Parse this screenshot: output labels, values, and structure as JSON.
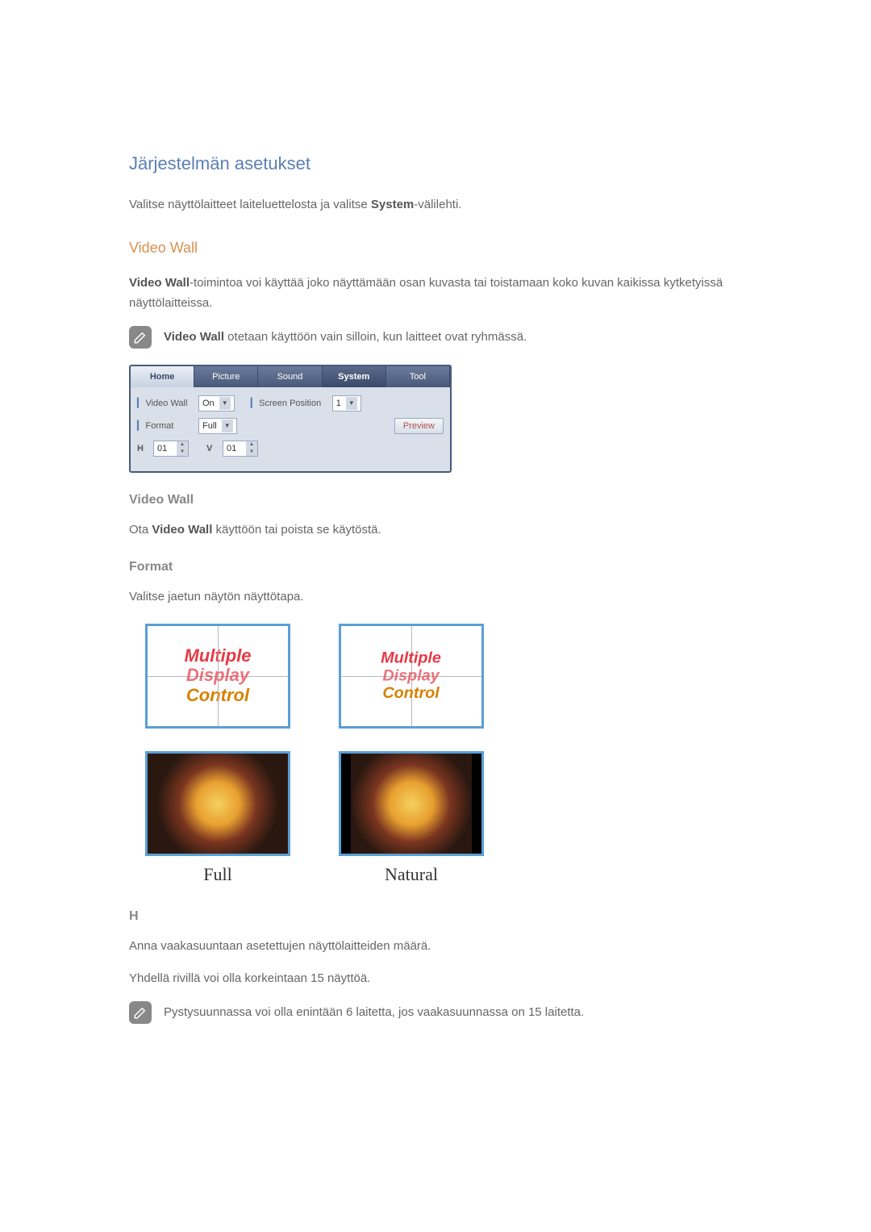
{
  "headings": {
    "system_settings": "Järjestelmän asetukset",
    "video_wall": "Video Wall",
    "vw_sub": "Video Wall",
    "format_sub": "Format",
    "h_sub": "H"
  },
  "text": {
    "intro_pre": "Valitse näyttölaitteet laiteluettelosta ja valitse ",
    "intro_bold": "System",
    "intro_post": "-välilehti.",
    "vw_desc_bold": "Video Wall",
    "vw_desc": "-toimintoa voi käyttää joko näyttämään osan kuvasta tai toistamaan koko kuvan kaikissa kytketyissä näyttölaitteissa.",
    "vw_note_bold": "Video Wall",
    "vw_note": " otetaan käyttöön vain silloin, kun laitteet ovat ryhmässä.",
    "vw_toggle_pre": "Ota ",
    "vw_toggle_bold": "Video Wall",
    "vw_toggle_post": " käyttöön tai poista se käytöstä.",
    "format_desc": "Valitse jaetun näytön näyttötapa.",
    "format_full": "Full",
    "format_natural": "Natural",
    "h_desc1": "Anna vaakasuuntaan asetettujen näyttölaitteiden määrä.",
    "h_desc2": "Yhdellä rivillä voi olla korkeintaan 15 näyttöä.",
    "h_note": "Pystysuunnassa voi olla enintään 6 laitetta, jos vaakasuunnassa on 15 laitetta."
  },
  "panel": {
    "tabs": [
      "Home",
      "Picture",
      "Sound",
      "System",
      "Tool"
    ],
    "video_wall_label": "Video Wall",
    "video_wall_value": "On",
    "screen_position_label": "Screen Position",
    "screen_position_value": "1",
    "format_label": "Format",
    "format_value": "Full",
    "preview_label": "Preview",
    "h_label": "H",
    "h_value": "01",
    "v_label": "V",
    "v_value": "01"
  },
  "mdc": {
    "l1": "Multiple",
    "l2": "Display",
    "l3": "Control"
  }
}
